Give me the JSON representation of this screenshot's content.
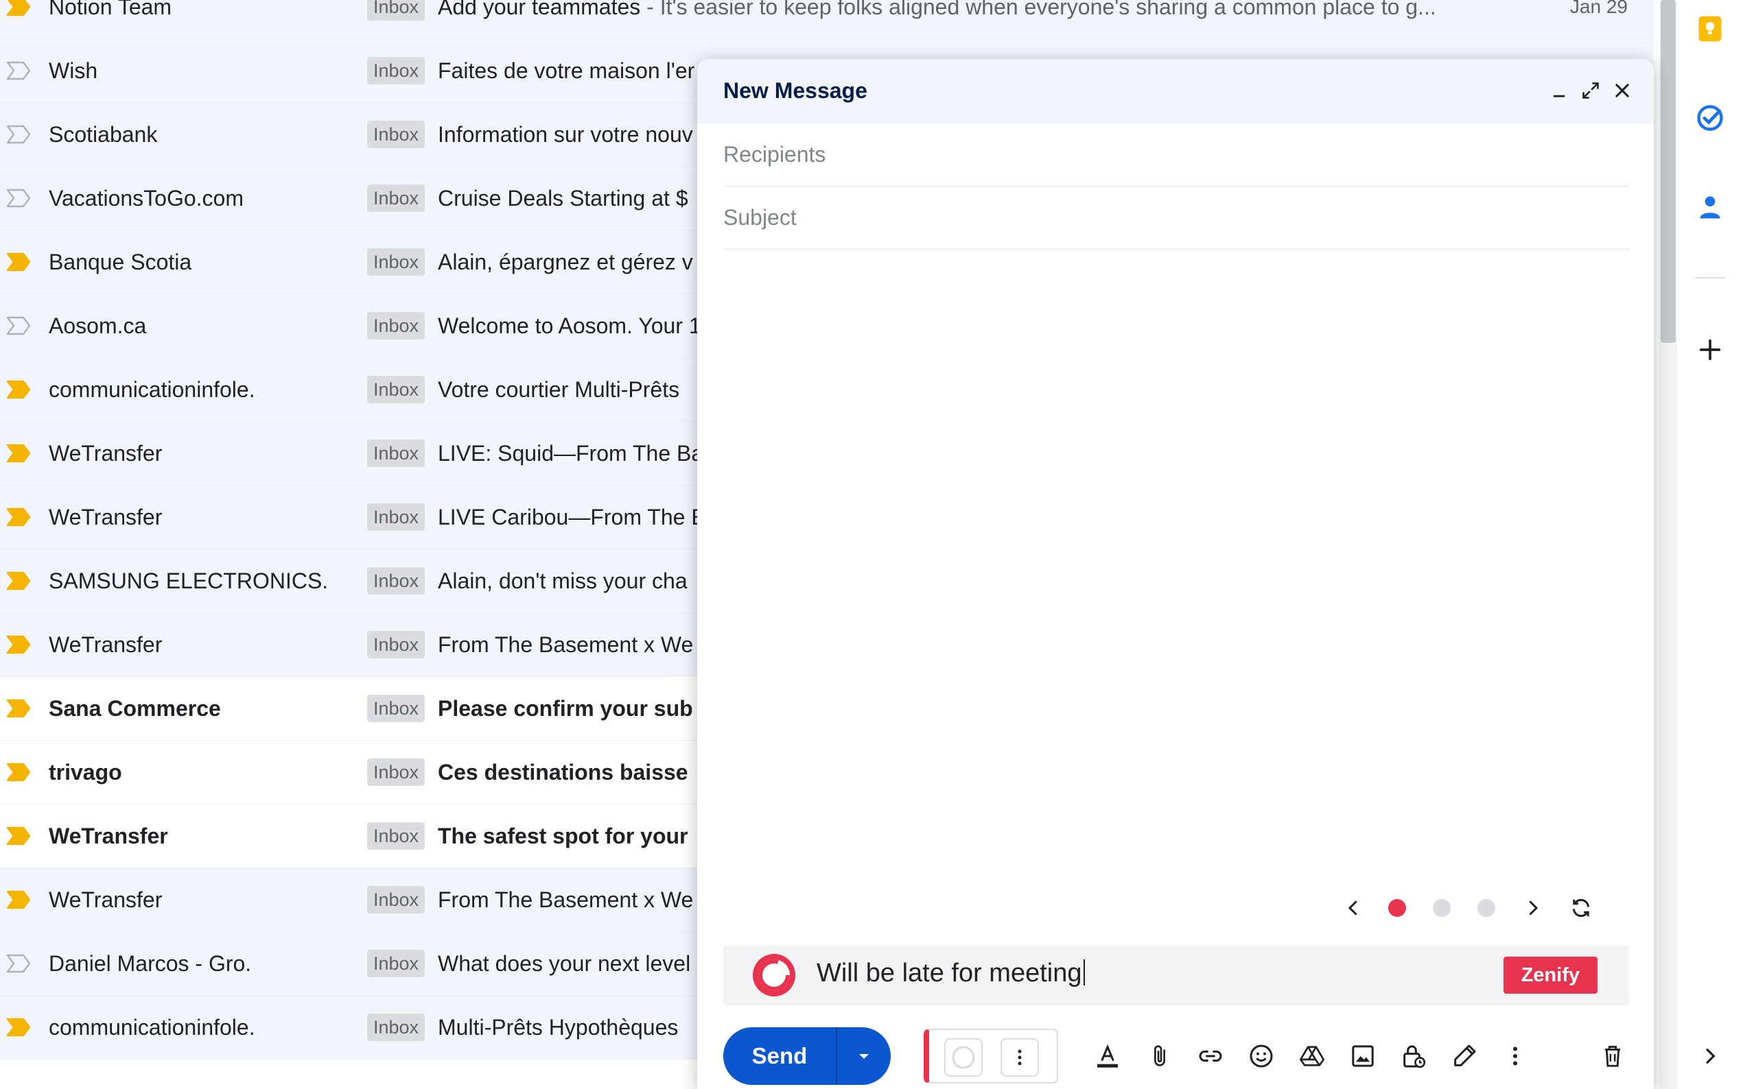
{
  "inbox": {
    "rows": [
      {
        "sender": "Notion Team",
        "label": "Inbox",
        "subject": "Add your teammates",
        "snippet": " - It's easier to keep folks aligned when everyone's sharing a common place to g...",
        "date": "Jan 29",
        "important": true,
        "unread": false
      },
      {
        "sender": "Wish",
        "label": "Inbox",
        "subject": "Faites de votre maison l'er",
        "snippet": "",
        "date": "",
        "important": false,
        "unread": false
      },
      {
        "sender": "Scotiabank",
        "label": "Inbox",
        "subject": "Information sur votre nouv",
        "snippet": "",
        "date": "",
        "important": false,
        "unread": false
      },
      {
        "sender": "VacationsToGo.com",
        "label": "Inbox",
        "subject": "Cruise Deals Starting at $",
        "snippet": "",
        "date": "",
        "important": false,
        "unread": false
      },
      {
        "sender": "Banque Scotia",
        "label": "Inbox",
        "subject": "Alain, épargnez et gérez v",
        "snippet": "",
        "date": "",
        "important": true,
        "unread": false
      },
      {
        "sender": "Aosom.ca",
        "label": "Inbox",
        "subject": "Welcome to Aosom. Your 1",
        "snippet": "",
        "date": "",
        "important": false,
        "unread": false
      },
      {
        "sender": "communicationinfole.",
        "label": "Inbox",
        "subject": "Votre courtier Multi-Prêts",
        "snippet": "",
        "date": "",
        "important": true,
        "unread": false
      },
      {
        "sender": "WeTransfer",
        "label": "Inbox",
        "subject": "LIVE: Squid—From The Ba",
        "snippet": "",
        "date": "",
        "important": true,
        "unread": false
      },
      {
        "sender": "WeTransfer",
        "label": "Inbox",
        "subject": "LIVE Caribou—From The E",
        "snippet": "",
        "date": "",
        "important": true,
        "unread": false
      },
      {
        "sender": "SAMSUNG ELECTRONICS.",
        "label": "Inbox",
        "subject": "Alain, don't miss your cha",
        "snippet": "",
        "date": "",
        "important": true,
        "unread": false
      },
      {
        "sender": "WeTransfer",
        "label": "Inbox",
        "subject": "From The Basement x We",
        "snippet": "",
        "date": "",
        "important": true,
        "unread": false
      },
      {
        "sender": "Sana Commerce",
        "label": "Inbox",
        "subject": "Please confirm your sub",
        "snippet": "",
        "date": "",
        "important": true,
        "unread": true
      },
      {
        "sender": "trivago",
        "label": "Inbox",
        "subject": "Ces destinations baisse",
        "snippet": "",
        "date": "",
        "important": true,
        "unread": true
      },
      {
        "sender": "WeTransfer",
        "label": "Inbox",
        "subject": "The safest spot for your",
        "snippet": "",
        "date": "",
        "important": true,
        "unread": true
      },
      {
        "sender": "WeTransfer",
        "label": "Inbox",
        "subject": "From The Basement x We",
        "snippet": "",
        "date": "",
        "important": true,
        "unread": false
      },
      {
        "sender": "Daniel Marcos - Gro.",
        "label": "Inbox",
        "subject": "What does your next level",
        "snippet": "",
        "date": "",
        "important": false,
        "unread": false
      },
      {
        "sender": "communicationinfole.",
        "label": "Inbox",
        "subject": "Multi-Prêts Hypothèques",
        "snippet": "",
        "date": "",
        "important": true,
        "unread": false
      }
    ]
  },
  "compose": {
    "title": "New Message",
    "recipients_placeholder": "Recipients",
    "subject_placeholder": "Subject",
    "suggestion_dots_active": 0,
    "zenify": {
      "input_text": "Will be late for meeting",
      "button_label": "Zenify"
    },
    "send_label": "Send"
  },
  "colors": {
    "accent_blue": "#0b57d0",
    "zenify_red": "#e8334f",
    "important_yellow": "#f4b400",
    "dot_inactive": "#dadce0"
  }
}
